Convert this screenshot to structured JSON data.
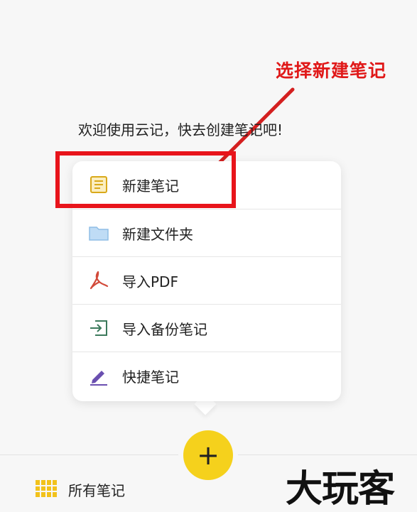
{
  "annotation": {
    "text": "选择新建笔记",
    "color": "#e01818"
  },
  "welcome": {
    "text": "欢迎使用云记，快去创建笔记吧!"
  },
  "menu": {
    "items": [
      {
        "label": "新建笔记",
        "icon": "note-icon"
      },
      {
        "label": "新建文件夹",
        "icon": "folder-icon"
      },
      {
        "label": "导入PDF",
        "icon": "pdf-icon"
      },
      {
        "label": "导入备份笔记",
        "icon": "import-icon"
      },
      {
        "label": "快捷笔记",
        "icon": "pen-icon"
      }
    ]
  },
  "bottom_bar": {
    "all_notes_label": "所有笔记",
    "fab_label": "+"
  },
  "watermark": {
    "text": "大玩客"
  },
  "colors": {
    "accent": "#f5d11c",
    "highlight": "#e8141b"
  }
}
